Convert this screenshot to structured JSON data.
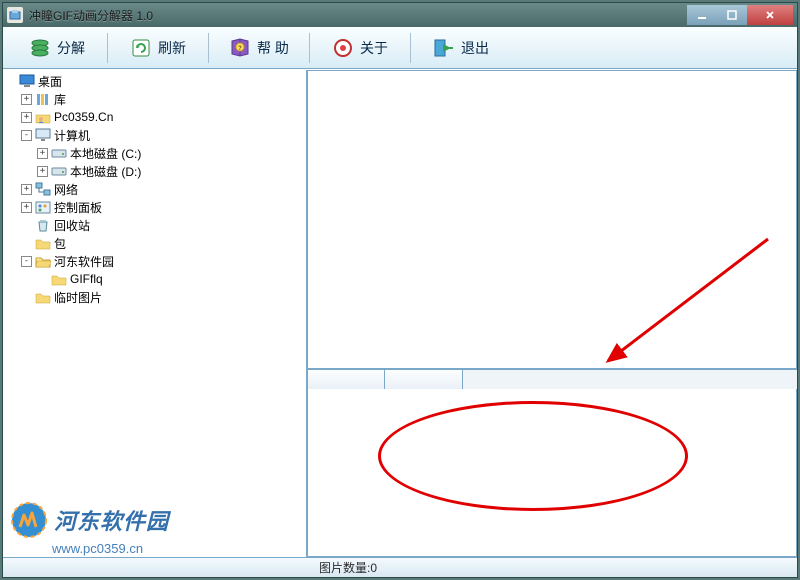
{
  "window": {
    "title": "冲瞳GIF动画分解器 1.0"
  },
  "toolbar": {
    "decompose": "分解",
    "refresh": "刷新",
    "help": "帮 助",
    "about": "关于",
    "exit": "退出"
  },
  "tree": {
    "root": "桌面",
    "items": [
      {
        "level": 0,
        "exp": "",
        "icon": "desktop",
        "label": "桌面"
      },
      {
        "level": 1,
        "exp": "+",
        "icon": "lib",
        "label": "库"
      },
      {
        "level": 1,
        "exp": "+",
        "icon": "user",
        "label": "Pc0359.Cn"
      },
      {
        "level": 1,
        "exp": "-",
        "icon": "computer",
        "label": "计算机"
      },
      {
        "level": 2,
        "exp": "+",
        "icon": "drive",
        "label": "本地磁盘 (C:)"
      },
      {
        "level": 2,
        "exp": "+",
        "icon": "drive",
        "label": "本地磁盘 (D:)"
      },
      {
        "level": 1,
        "exp": "+",
        "icon": "network",
        "label": "网络"
      },
      {
        "level": 1,
        "exp": "+",
        "icon": "control",
        "label": "控制面板"
      },
      {
        "level": 1,
        "exp": "",
        "icon": "recycle",
        "label": "回收站"
      },
      {
        "level": 1,
        "exp": "",
        "icon": "folder",
        "label": "包"
      },
      {
        "level": 1,
        "exp": "-",
        "icon": "folder-open",
        "label": "河东软件园"
      },
      {
        "level": 2,
        "exp": "",
        "icon": "folder",
        "label": "GIFflq"
      },
      {
        "level": 1,
        "exp": "",
        "icon": "folder",
        "label": "临时图片"
      }
    ]
  },
  "status": {
    "count_label": "图片数量:",
    "count_value": "0"
  },
  "watermark": {
    "brand": "河东软件园",
    "url": "www.pc0359.cn"
  },
  "colors": {
    "accent": "#2a6aa8",
    "annotation": "#e00000"
  }
}
